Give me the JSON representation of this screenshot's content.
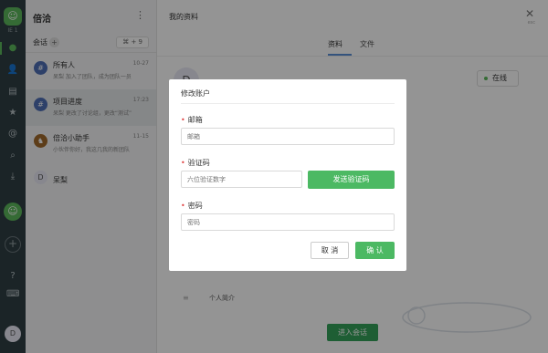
{
  "rail": {
    "workspace_label": "IE 1",
    "icons": [
      "chat-icon",
      "contacts-icon",
      "files-icon",
      "star-icon",
      "mention-icon",
      "search-icon",
      "download-icon",
      "help-icon",
      "keyboard-icon"
    ],
    "user_initial": "D",
    "accent": "#5cb85c"
  },
  "sessions": {
    "title": "倍洽",
    "tab_label": "会话",
    "shortcut": "⌘ + 9",
    "items": [
      {
        "name": "所有人",
        "time": "10-27",
        "preview": "呆梨 加入了团队，成为团队一员",
        "avatar": "#",
        "avatar_color": "#4f6fb5"
      },
      {
        "name": "项目进度",
        "time": "17:23",
        "preview": "呆梨 更改了讨论组，更改“测试”",
        "avatar": "#",
        "avatar_color": "#4f6fb5"
      },
      {
        "name": "倍洽小助手",
        "time": "11-15",
        "preview": "小伙伴你好，我这几我的新团队",
        "avatar": "",
        "avatar_color": "#a06a2c"
      },
      {
        "name": "呆梨",
        "time": "",
        "preview": "",
        "avatar": "D",
        "avatar_color": "#e8e8f4"
      }
    ]
  },
  "main": {
    "title": "我的资料",
    "close_hint": "esc",
    "tabs": [
      "资料",
      "文件"
    ],
    "profile_initial": "D",
    "status": "在线",
    "bio_label": "个人简介",
    "enter_button": "进入会话"
  },
  "modal": {
    "title": "修改账户",
    "email_label": "邮箱",
    "email_placeholder": "邮箱",
    "code_label": "验证码",
    "code_placeholder": "六位验证数字",
    "send_button": "发送验证码",
    "password_label": "密码",
    "password_placeholder": "密码",
    "cancel_button": "取 消",
    "confirm_button": "确 认",
    "accent": "#4cb963"
  }
}
